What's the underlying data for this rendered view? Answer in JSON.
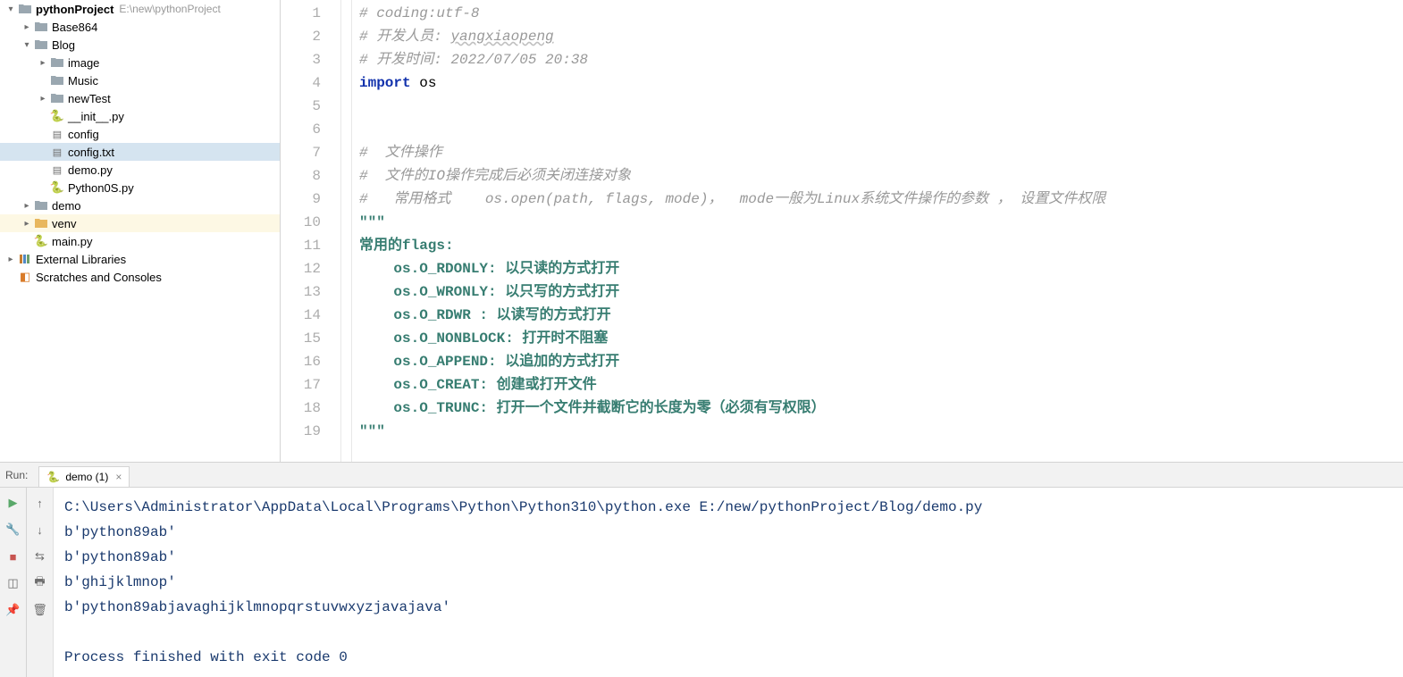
{
  "project": {
    "name": "pythonProject",
    "path": "E:\\new\\pythonProject"
  },
  "tree": {
    "base864": "Base864",
    "blog": "Blog",
    "image": "image",
    "music": "Music",
    "newtest": "newTest",
    "init": "__init__.py",
    "config": "config",
    "configtxt": "config.txt",
    "demopy": "demo.py",
    "python0s": "Python0S.py",
    "demo": "demo",
    "venv": "venv",
    "main": "main.py",
    "extlib": "External Libraries",
    "scratches": "Scratches and Consoles"
  },
  "code": {
    "l1": "# coding:utf-8",
    "l2a": "# 开发人员: ",
    "l2b": "yangxiaopeng",
    "l3": "# 开发时间: 2022/07/05 20:38",
    "l4a": "import",
    "l4b": " os",
    "l5": "",
    "l6": "",
    "l7": "#  文件操作",
    "l8": "#  文件的IO操作完成后必须关闭连接对象",
    "l9": "#   常用格式    os.open(path, flags, mode)，  mode一般为Linux系统文件操作的参数 ， 设置文件权限",
    "l10": "\"\"\"",
    "l11": "常用的flags:",
    "l12": "    os.O_RDONLY: 以只读的方式打开",
    "l13": "    os.O_WRONLY: 以只写的方式打开",
    "l14": "    os.O_RDWR : 以读写的方式打开",
    "l15": "    os.O_NONBLOCK: 打开时不阻塞",
    "l16": "    os.O_APPEND: 以追加的方式打开",
    "l17": "    os.O_CREAT: 创建或打开文件",
    "l18": "    os.O_TRUNC: 打开一个文件并截断它的长度为零（必须有写权限）",
    "l19": "\"\"\""
  },
  "run": {
    "label": "Run:",
    "tab": "demo (1)"
  },
  "console": {
    "cmd": "C:\\Users\\Administrator\\AppData\\Local\\Programs\\Python\\Python310\\python.exe E:/new/pythonProject/Blog/demo.py",
    "o1": "b'python89ab'",
    "o2": "b'python89ab'",
    "o3": "b'ghijklmnop'",
    "o4": "b'python89abjavaghijklmnopqrstuvwxyzjavajava'",
    "exit": "Process finished with exit code 0"
  }
}
